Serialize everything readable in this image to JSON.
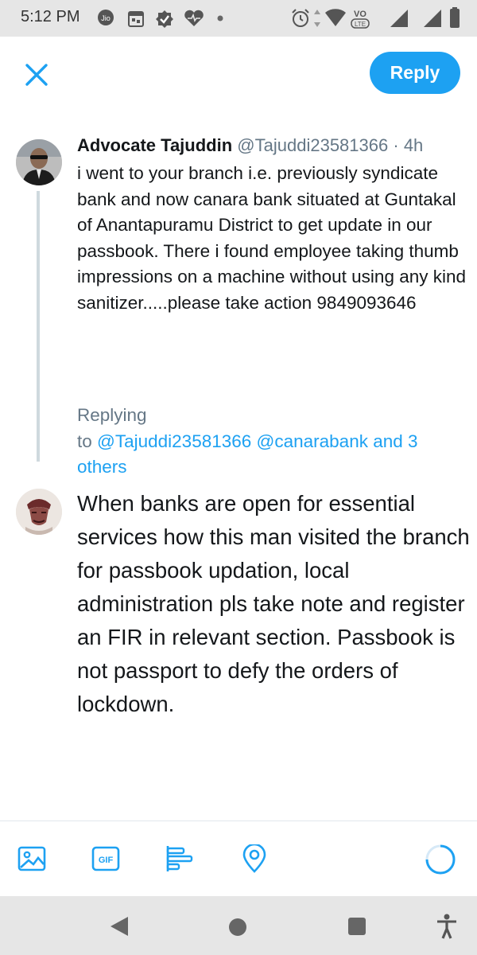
{
  "status_bar": {
    "time": "5:12 PM",
    "carrier_icon_label": "Jio",
    "network_label_top": "VO",
    "network_label_bottom": "LTE",
    "icons": [
      "jio-icon",
      "calendar-icon",
      "check-badge-icon",
      "heart-icon",
      "notification-dot-icon",
      "alarm-icon",
      "data-arrows-icon",
      "wifi-icon",
      "volte-icon",
      "signal-icon",
      "signal-icon",
      "battery-icon"
    ]
  },
  "header": {
    "close_icon": "close-icon",
    "reply_label": "Reply"
  },
  "tweet": {
    "author_name": "Advocate Tajuddin",
    "handle": "@Tajuddi23581366",
    "separator": "·",
    "age": "4h",
    "text": "i went to your branch i.e. previously syndicate bank and now canara bank situated at Guntakal of Anantapuramu District to get update in our passbook. There i found employee taking thumb impressions on a machine without using any kind sanitizer.....please take action 9849093646"
  },
  "replying_to": {
    "prefix": "Replying",
    "to_word": "to",
    "mentions": "@Tajuddi23581366 @canarabank and 3 others"
  },
  "compose": {
    "text": "When banks are open for essential services how this man visited the branch for passbook updation, local administration pls take note and register an FIR in relevant section. Passbook is not passport to defy the orders of lockdown."
  },
  "toolbar": {
    "icons": [
      "image-icon",
      "gif-icon",
      "poll-icon",
      "location-icon",
      "progress-ring-icon"
    ],
    "gif_label": "GIF"
  },
  "nav_bar": {
    "icons": [
      "back-icon",
      "home-icon",
      "recents-icon",
      "accessibility-icon"
    ]
  },
  "colors": {
    "accent": "#1da1f2",
    "secondary_text": "#657786",
    "thread_line": "#cfd9de",
    "system_bar": "#e6e6e6"
  }
}
